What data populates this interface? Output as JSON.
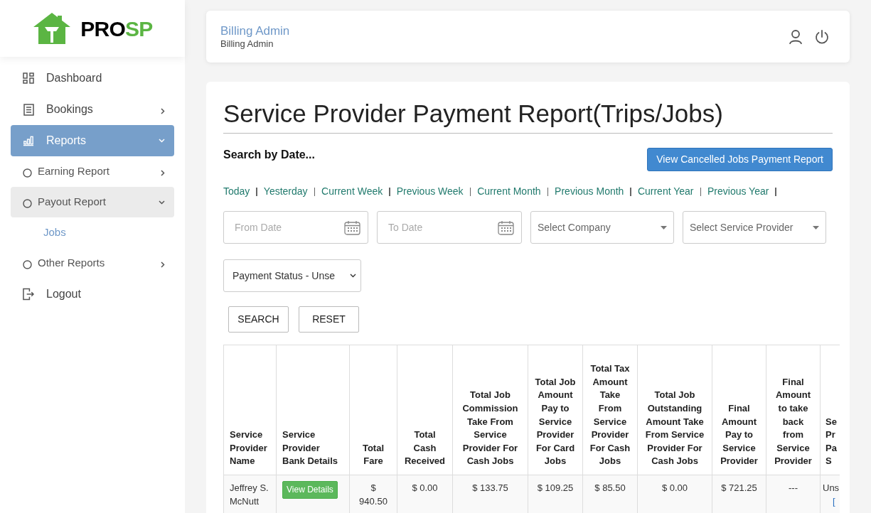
{
  "brand": {
    "dark": "PRO",
    "accent": "SP"
  },
  "user": {
    "name": "Billing Admin",
    "role": "Billing Admin"
  },
  "sidebar": {
    "items": [
      {
        "kind": "link",
        "label": "Dashboard",
        "selected": false
      },
      {
        "kind": "menu",
        "label": "Bookings",
        "selected": false,
        "expanded": false
      },
      {
        "kind": "menu",
        "label": "Reports",
        "selected": true,
        "expanded": true,
        "children": [
          {
            "kind": "menu",
            "label": "Earning Report",
            "selected": false,
            "expanded": false
          },
          {
            "kind": "menu",
            "label": "Payout Report",
            "selected": true,
            "expanded": true,
            "children": [
              {
                "kind": "link",
                "label": "Jobs",
                "selected": true
              }
            ]
          },
          {
            "kind": "menu",
            "label": "Other Reports",
            "selected": false,
            "expanded": false
          }
        ]
      },
      {
        "kind": "link",
        "label": "Logout",
        "selected": false
      }
    ]
  },
  "report": {
    "title": "Service Provider Payment Report(Trips/Jobs)",
    "search_label": "Search by Date...",
    "cancelled_button": "View Cancelled Jobs Payment Report",
    "quick_ranges": [
      "Today",
      "Yesterday",
      "Current Week",
      "Previous Week",
      "Current Month",
      "Previous Month",
      "Current Year",
      "Previous Year"
    ],
    "filters": [
      {
        "kind": "date",
        "placeholder": "From Date"
      },
      {
        "kind": "date",
        "placeholder": "To Date"
      },
      {
        "kind": "select",
        "placeholder": "Select Company"
      },
      {
        "kind": "select",
        "placeholder": "Select Service Provider"
      },
      {
        "kind": "status",
        "value": "Payment Status - Unse"
      }
    ],
    "buttons": [
      "SEARCH",
      "RESET"
    ],
    "table": {
      "columns": [
        "Service Provider Name",
        "Service Provider Bank Details",
        "Total Fare",
        "Total Cash Received",
        "Total Job Commission Take From Service Provider For Cash Jobs",
        "Total Job Amount Pay to Service Provider For Card Jobs",
        "Total Tax Amount Take From Service Provider For Cash Jobs",
        "Total Job Outstanding Amount Take From Service Provider For Cash Jobs",
        "Final Amount Pay to Service Provider",
        "Final Amount to take back from Service Provider",
        "Se Pr Pa S"
      ],
      "rows": [
        {
          "name": "Jeffrey S. McNutt",
          "bank_button": "View Details",
          "total_fare": "$ 940.50",
          "cash_received": "$ 0.00",
          "commission": "$ 133.75",
          "card_pay": "$ 109.25",
          "tax": "$ 85.50",
          "outstanding": "$ 0.00",
          "final_pay": "$ 721.25",
          "take_back": "---",
          "status": "Uns",
          "status_link": "["
        }
      ]
    }
  }
}
